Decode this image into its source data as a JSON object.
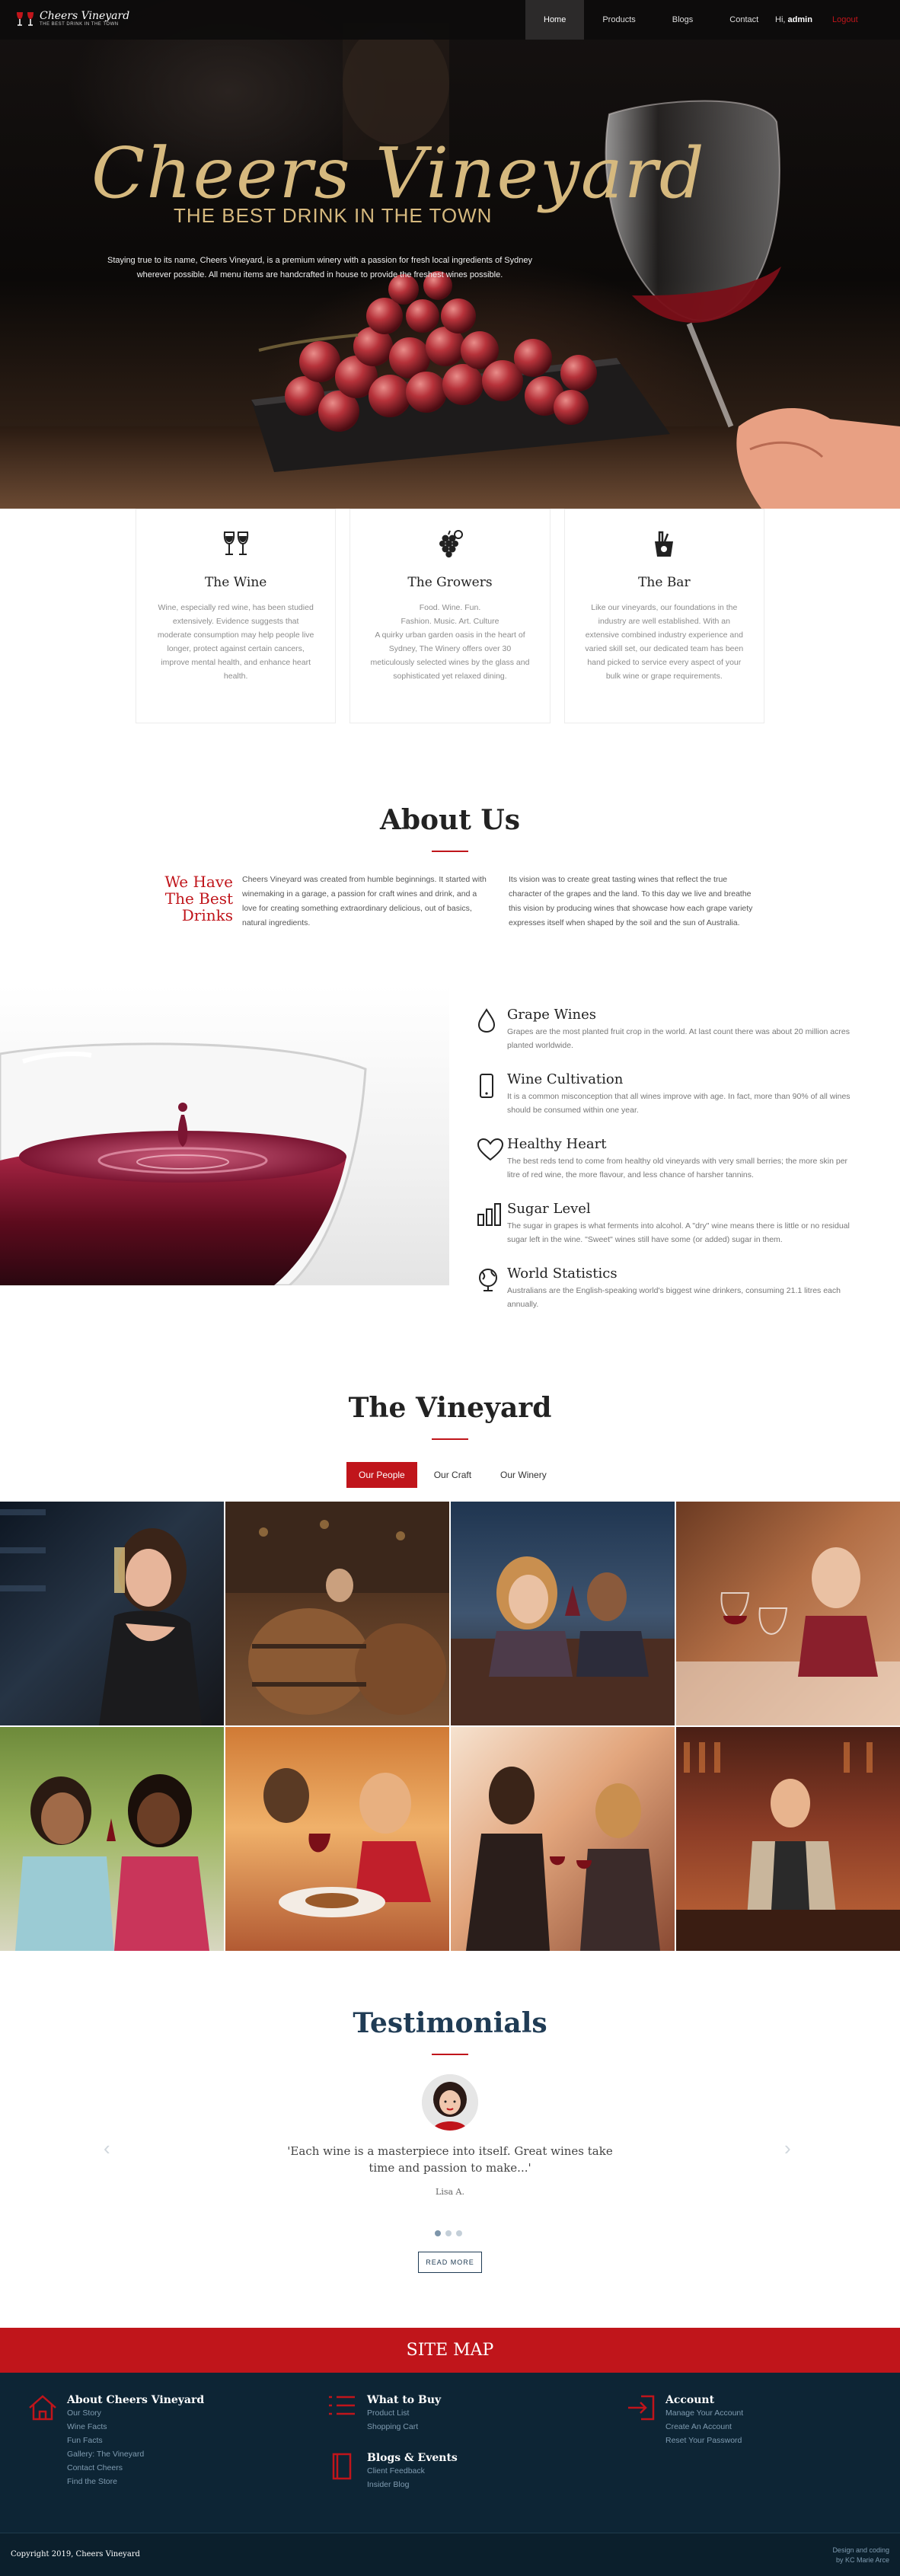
{
  "nav": {
    "logo_title": "Cheers Vineyard",
    "logo_tagline": "THE BEST DRINK IN THE TOWN",
    "menu": [
      "Home",
      "Products",
      "Blogs",
      "Contact"
    ],
    "greeting": "Hi,",
    "username": "admin",
    "logout": "Logout"
  },
  "hero": {
    "title": "Cheers Vineyard",
    "subtitle": "THE BEST DRINK IN THE TOWN",
    "text": "Staying true to its name, Cheers Vineyard, is a premium winery with a passion for fresh local ingredients of Sydney wherever possible. All menu items are handcrafted in house to provide the freshest wines possible."
  },
  "cards": [
    {
      "icon": "wine-glasses-icon",
      "title": "The Wine",
      "text": "Wine, especially red wine, has been studied extensively. Evidence suggests that moderate consumption may help people live longer, protect against certain cancers, improve mental health, and enhance heart health."
    },
    {
      "icon": "grapes-icon",
      "title": "The Growers",
      "text_lines": [
        "Food. Wine. Fun.",
        "Fashion. Music. Art. Culture"
      ],
      "text": "A quirky urban garden oasis in the heart of Sydney, The Winery offers over 30 meticulously selected wines by the glass and sophisticated yet relaxed dining."
    },
    {
      "icon": "ice-bucket-icon",
      "title": "The Bar",
      "text": "Like our vineyards, our foundations in the industry are well established. With an extensive combined industry experience and varied skill set, our dedicated team has been hand picked to service every aspect of your bulk wine or grape requirements."
    }
  ],
  "about": {
    "title": "About Us",
    "tagline": "We Have The Best Drinks",
    "col1": "Cheers Vineyard was created from humble beginnings. It started with winemaking in a garage, a passion for craft wines and drink, and a love for creating something extraordinary delicious, out of basics, natural ingredients.",
    "col2": "Its vision was to create great tasting wines that reflect the true character of the grapes and the land. To this day we live and breathe this vision by producing wines that showcase how each grape variety expresses itself when shaped by the soil and the sun of Australia."
  },
  "facts": [
    {
      "icon": "drop-icon",
      "title": "Grape Wines",
      "text": "Grapes are the most planted fruit crop in the world. At last count there was about 20 million acres planted worldwide."
    },
    {
      "icon": "phone-icon",
      "title": "Wine Cultivation",
      "text": "It is a common misconception that all wines improve with age. In fact, more than 90% of all wines should be consumed within one year."
    },
    {
      "icon": "heart-icon",
      "title": "Healthy Heart",
      "text": "The best reds tend to come from healthy old vineyards with very small berries; the more skin per litre of red wine, the more flavour, and less chance of harsher tannins."
    },
    {
      "icon": "bar-chart-icon",
      "title": "Sugar Level",
      "text": "The sugar in grapes is what ferments into alcohol. A \"dry\" wine means there is little or no residual sugar left in the wine. \"Sweet\" wines still have some (or added) sugar in them."
    },
    {
      "icon": "globe-icon",
      "title": "World Statistics",
      "text": "Australians are the English-speaking world's biggest wine drinkers, consuming 21.1 litres each annually."
    }
  ],
  "vineyard": {
    "title": "The Vineyard",
    "tabs": [
      "Our People",
      "Our Craft",
      "Our Winery"
    ],
    "active_tab": "Our People"
  },
  "testimonials": {
    "title": "Testimonials",
    "quote": "'Each wine is a masterpiece into itself. Great wines take time and passion to make...'",
    "author": "Lisa A.",
    "button": "READ MORE",
    "prev": "‹",
    "next": "›"
  },
  "footer": {
    "sitemap": "SITE MAP",
    "columns": [
      {
        "icon": "home-icon",
        "title": "About Cheers Vineyard",
        "links": [
          "Our Story",
          "Wine Facts",
          "Fun Facts",
          "Gallery: The Vineyard",
          "Contact Cheers",
          "Find the Store"
        ]
      },
      {
        "icon": "list-icon",
        "title": "What to Buy",
        "links": [
          "Product List",
          "Shopping Cart"
        ]
      },
      {
        "icon": "book-icon",
        "title": "Blogs & Events",
        "links": [
          "Client Feedback",
          "Insider Blog"
        ]
      },
      {
        "icon": "login-icon",
        "title": "Account",
        "links": [
          "Manage Your Account",
          "Create An Account",
          "Reset Your Password"
        ]
      }
    ],
    "copyright": "Copyright 2019, Cheers Vineyard",
    "credit_line1": "Design and coding",
    "credit_line2": "by KC Marie Arce"
  },
  "colors": {
    "accent": "#c0151b",
    "navy": "#0d2535",
    "gold": "#d6b97e"
  }
}
